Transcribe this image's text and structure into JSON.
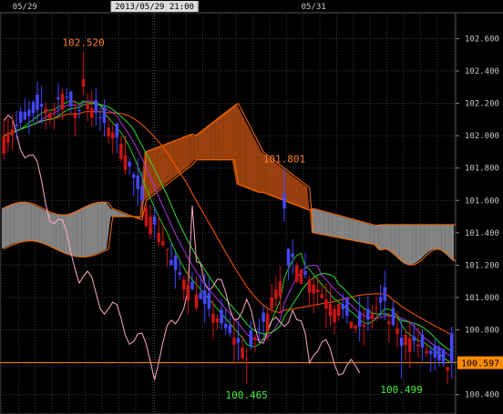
{
  "chart_data": {
    "type": "candlestick",
    "date_labels": [
      {
        "text": "05/29",
        "t": 5
      },
      {
        "text": "05/31",
        "t": 74
      }
    ],
    "cursor_label": "2013/05/29 21:00",
    "cursor_t": 36,
    "current_price": {
      "label": "100.597",
      "value": 100.597
    },
    "y_ticks": [
      102.6,
      102.4,
      102.2,
      102.0,
      101.8,
      101.6,
      101.4,
      101.2,
      101.0,
      100.8,
      100.6,
      100.4
    ],
    "y_tick_labels": [
      "102.600",
      "102.400",
      "102.200",
      "102.000",
      "101.800",
      "101.600",
      "101.400",
      "101.200",
      "101.000",
      "100.800",
      "100.600",
      "100.400"
    ],
    "ylim": [
      100.28,
      102.76
    ],
    "x_count": 108,
    "annotations": [
      {
        "text": "102.520",
        "t": 19,
        "value": 102.52,
        "color": "#ff7f27"
      },
      {
        "text": "101.801",
        "t": 67,
        "value": 101.801,
        "color": "#ff7f27"
      },
      {
        "text": "100.465",
        "t": 58,
        "value": 100.465,
        "color": "#44ee44"
      },
      {
        "text": "100.499",
        "t": 95,
        "value": 100.499,
        "color": "#44ee44"
      }
    ],
    "colors": {
      "bull": "#cc1414",
      "bear": "#4646ff",
      "grid": "#3a3a3a",
      "price_line": "#ff8c00",
      "cloud_bear": "#c05010",
      "cloud_bull": "#9a9a9a",
      "span_a": "#ff6a00",
      "span_b": "#ff6a00",
      "tenkan": "#aa33dd",
      "kijun": "#ff5a00",
      "ma1": "#22cc22",
      "ma2": "#33dd33",
      "chikou": "#ffaacc"
    }
  }
}
